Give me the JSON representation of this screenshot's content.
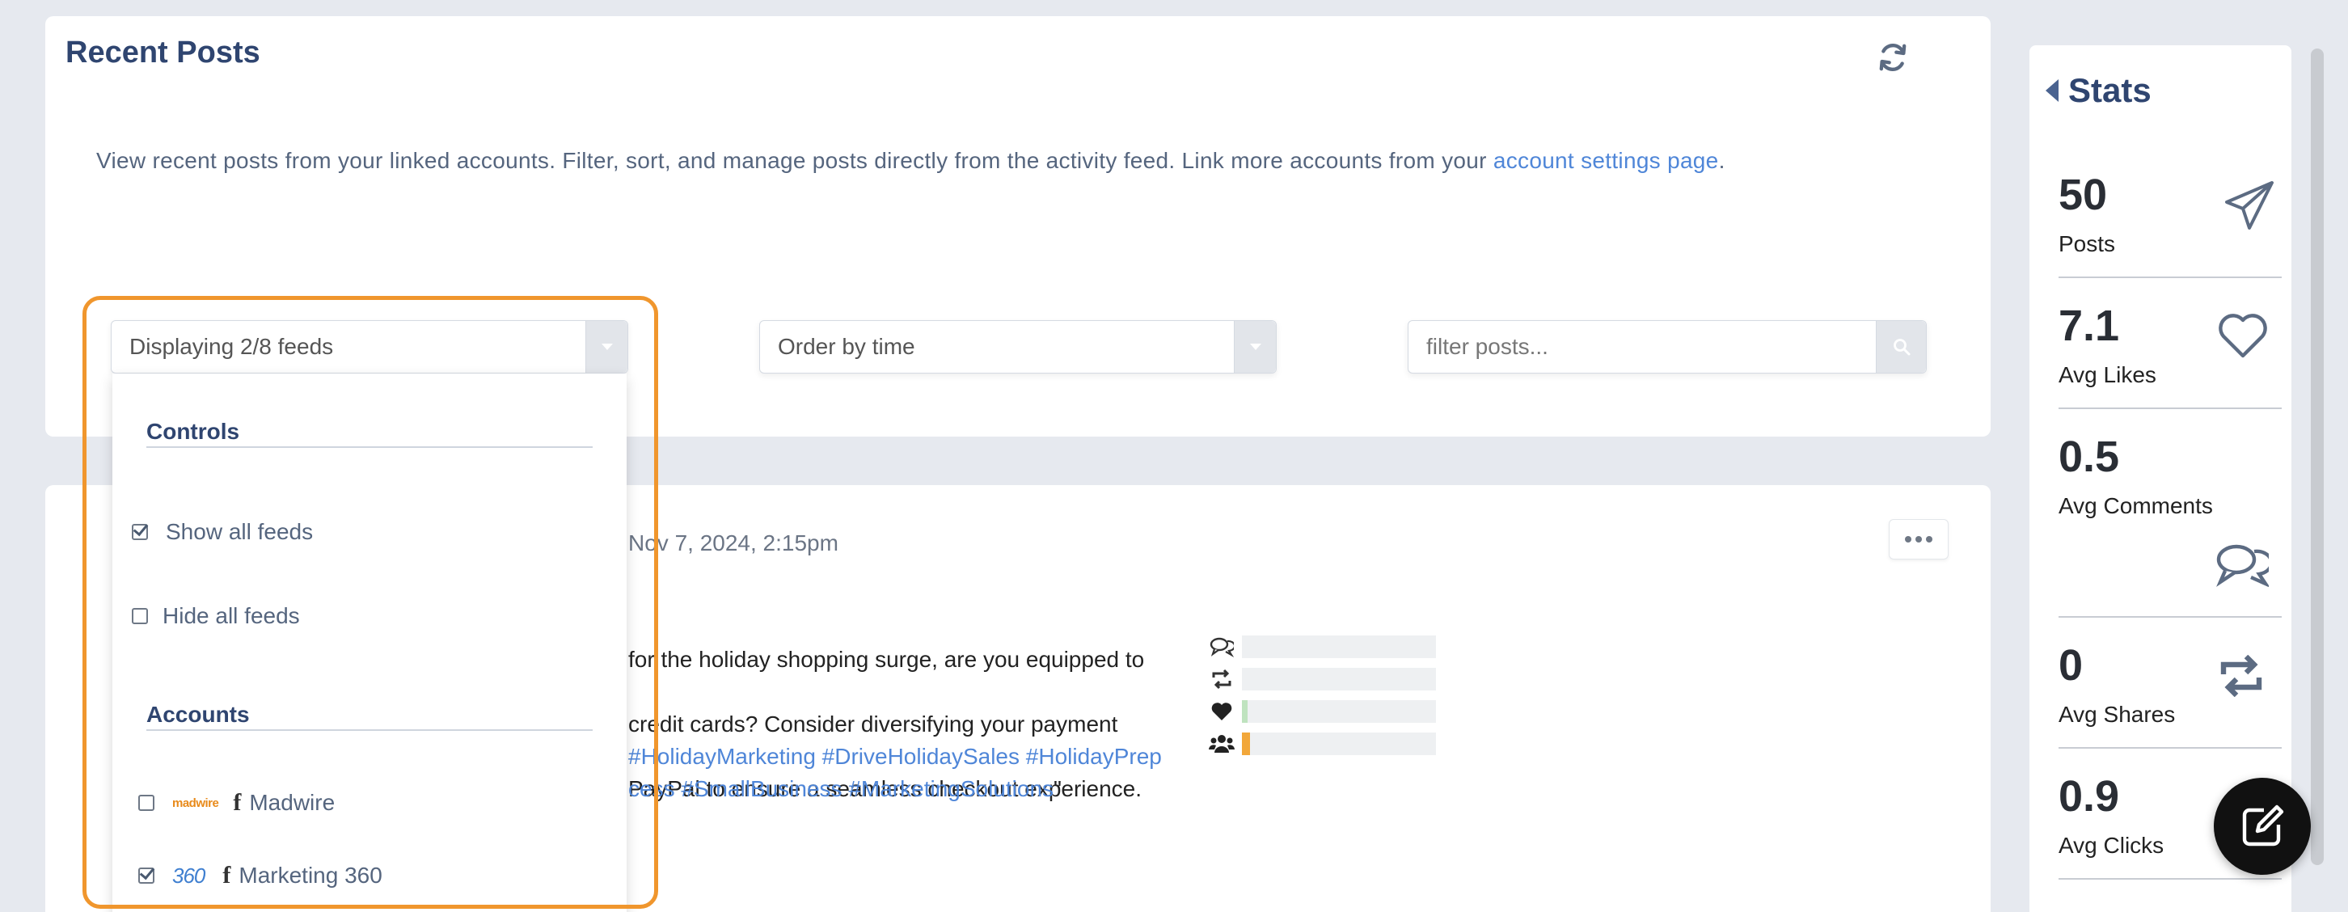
{
  "header": {
    "title": "Recent Posts",
    "refresh_icon": "refresh-icon",
    "description": "View recent posts from your linked accounts. Filter, sort, and manage posts directly from the activity feed. Link more accounts from your ",
    "description_link": "account settings page",
    "description_end": "."
  },
  "controls": {
    "feed_select": "Displaying 2/8 feeds",
    "order_select": "Order by time",
    "filter_placeholder": "filter posts..."
  },
  "dropdown": {
    "controls_heading": "Controls",
    "show_all": "Show all feeds",
    "hide_all": "Hide all feeds",
    "accounts_heading": "Accounts",
    "accounts": [
      {
        "logo": "madwire",
        "name": "Madwire",
        "checked": false
      },
      {
        "logo": "360",
        "name": "Marketing 360",
        "checked": true
      }
    ]
  },
  "post": {
    "date": "Nov 7, 2024, 2:15pm",
    "text_lines": [
      "for the holiday shopping surge, are you equipped to",
      " credit cards? Consider diversifying your payment",
      "PayPal to ensure a seamless checkout experience."
    ],
    "tags_line1": "#HolidayMarketing #DriveHolidaySales #HolidayPrep",
    "tags_line2": "cess #SmallBusiness #MarketingSolutions",
    "tags_end": "\"",
    "metrics": [
      {
        "icon": "comments-icon",
        "fraction": 0.0,
        "color": "#cfe6cf"
      },
      {
        "icon": "retweet-icon",
        "fraction": 0.0,
        "color": "#cfe6cf"
      },
      {
        "icon": "heart-icon",
        "fraction": 0.03,
        "color": "#bfe3bf"
      },
      {
        "icon": "users-icon",
        "fraction": 0.04,
        "color": "#f2a73a"
      }
    ]
  },
  "stats": {
    "title": "Stats",
    "items": [
      {
        "value": "50",
        "label": "Posts",
        "icon": "paper-plane-icon"
      },
      {
        "value": "7.1",
        "label": "Avg Likes",
        "icon": "heart-outline-icon"
      },
      {
        "value": "0.5",
        "label": "Avg Comments",
        "icon": "comments-outline-icon"
      },
      {
        "value": "0",
        "label": "Avg Shares",
        "icon": "retweet-icon"
      },
      {
        "value": "0.9",
        "label": "Avg Clicks",
        "icon": "cursor-icon"
      }
    ]
  },
  "fab_icon": "edit-icon"
}
